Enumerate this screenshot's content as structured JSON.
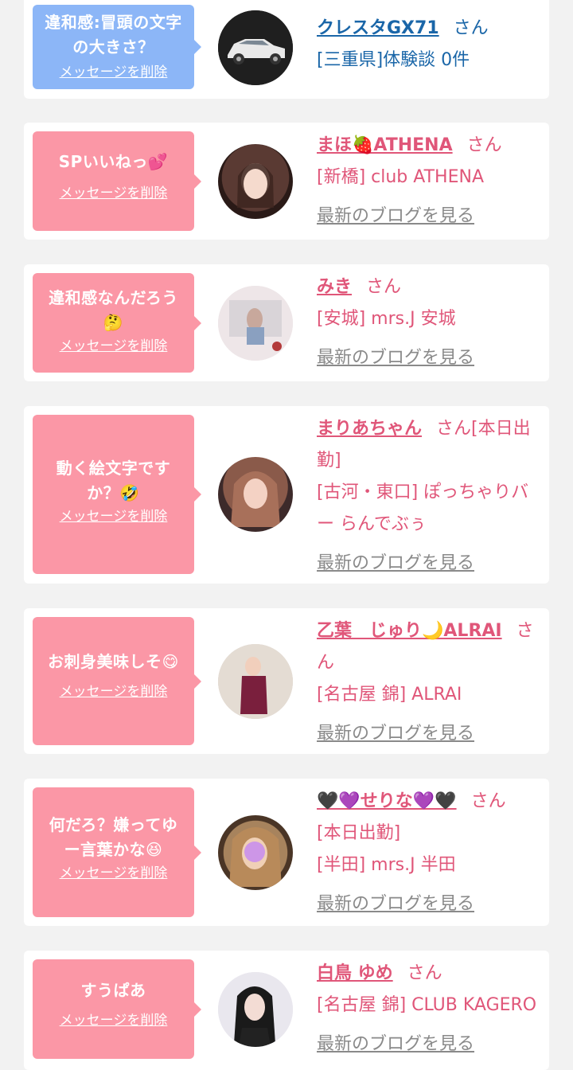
{
  "colors": {
    "background": "#f2f2f2",
    "card": "#ffffff",
    "bubble_blue": "#8cb6f7",
    "bubble_pink": "#fb97a6",
    "name_pink": "#e05679",
    "name_blue": "#1a66a8",
    "blog_gray": "#8a8a8a"
  },
  "entries": [
    {
      "bubble_color": "blue",
      "message_lines": [
        "違和感:冒頭の文字",
        "の大きさ？"
      ],
      "delete_label": "メッセージを削除",
      "avatar_icon": "car-photo",
      "name": "クレスタGX71",
      "honorific": "さん",
      "info_lines": [
        "[三重県]体験談 0件"
      ],
      "blog_label": ""
    },
    {
      "bubble_color": "pink",
      "message_lines": [
        "SPいいねっ💕"
      ],
      "delete_label": "メッセージを削除",
      "avatar_icon": "woman-photo",
      "name": "まほ🍓ATHENA",
      "honorific": "さん",
      "info_lines": [
        "[新橋] club ATHENA"
      ],
      "blog_label": "最新のブログを見る"
    },
    {
      "bubble_color": "pink",
      "message_lines": [
        "違和感なんだろう",
        "🤔"
      ],
      "delete_label": "メッセージを削除",
      "avatar_icon": "woman-photo",
      "name": "みき",
      "honorific": "さん",
      "info_lines": [
        "[安城] mrs.J 安城"
      ],
      "blog_label": "最新のブログを見る"
    },
    {
      "bubble_color": "pink",
      "message_lines": [
        "動く絵文字です",
        "か？🤣"
      ],
      "delete_label": "メッセージを削除",
      "avatar_icon": "woman-photo",
      "name": "まりあちゃん",
      "honorific": "さん[本日出勤]",
      "info_lines": [
        "[古河・東口] ぽっちゃりバー らんでぶぅ"
      ],
      "blog_label": "最新のブログを見る"
    },
    {
      "bubble_color": "pink",
      "message_lines": [
        "お刺身美味しそ😋"
      ],
      "delete_label": "メッセージを削除",
      "avatar_icon": "woman-photo",
      "name": "乙葉　じゅり🌙ALRAI",
      "honorific": "さん",
      "info_lines": [
        "[名古屋 錦] ALRAI"
      ],
      "blog_label": "最新のブログを見る"
    },
    {
      "bubble_color": "pink",
      "message_lines": [
        "何だろ？嫌ってゆ",
        "ー言葉かな😆"
      ],
      "delete_label": "メッセージを削除",
      "avatar_icon": "woman-photo",
      "name": "🖤💜せりな💜🖤",
      "honorific": "さん",
      "info_lines": [
        "[本日出勤]",
        "[半田] mrs.J 半田"
      ],
      "blog_label": "最新のブログを見る"
    },
    {
      "bubble_color": "pink",
      "message_lines": [
        "すうぱあ"
      ],
      "delete_label": "メッセージを削除",
      "avatar_icon": "woman-photo",
      "name": "白鳥 ゆめ",
      "honorific": "さん",
      "info_lines": [
        "[名古屋 錦] CLUB KAGERO"
      ],
      "blog_label": "最新のブログを見る"
    }
  ]
}
